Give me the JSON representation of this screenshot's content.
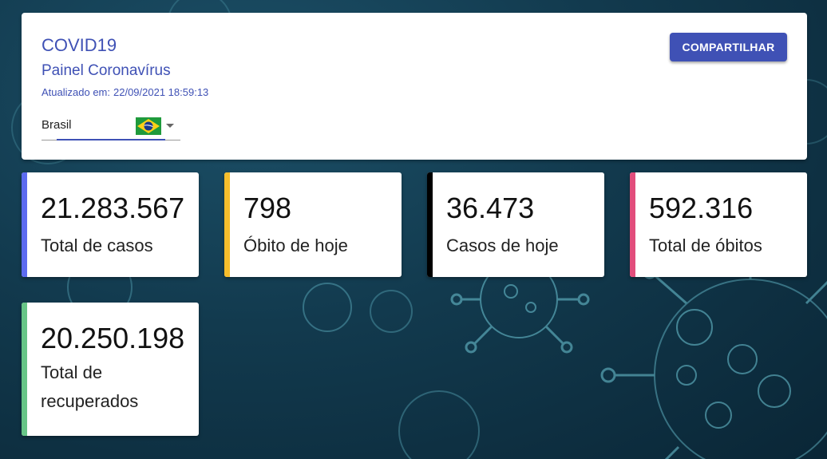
{
  "header": {
    "title": "COVID19",
    "subtitle": "Painel Coronavírus",
    "updated_label": "Atualizado em:",
    "updated_value": "22/09/2021 18:59:13",
    "share_label": "COMPARTILHAR",
    "country": "Brasil",
    "flag_icon": "brazil-flag-icon"
  },
  "stats": {
    "total_casos": {
      "value": "21.283.567",
      "label": "Total de casos",
      "color": "#5c6bf0"
    },
    "obito_hoje": {
      "value": "798",
      "label": "Óbito de hoje",
      "color": "#f6be2c"
    },
    "casos_hoje": {
      "value": "36.473",
      "label": "Casos de hoje",
      "color": "#000000"
    },
    "total_obitos": {
      "value": "592.316",
      "label": "Total de óbitos",
      "color": "#e24d7c"
    },
    "recuperados": {
      "value": "20.250.198",
      "label": "Total de recuperados",
      "color": "#67c587"
    }
  },
  "colors": {
    "accent": "#3f51b5",
    "background": "#123a4e"
  }
}
